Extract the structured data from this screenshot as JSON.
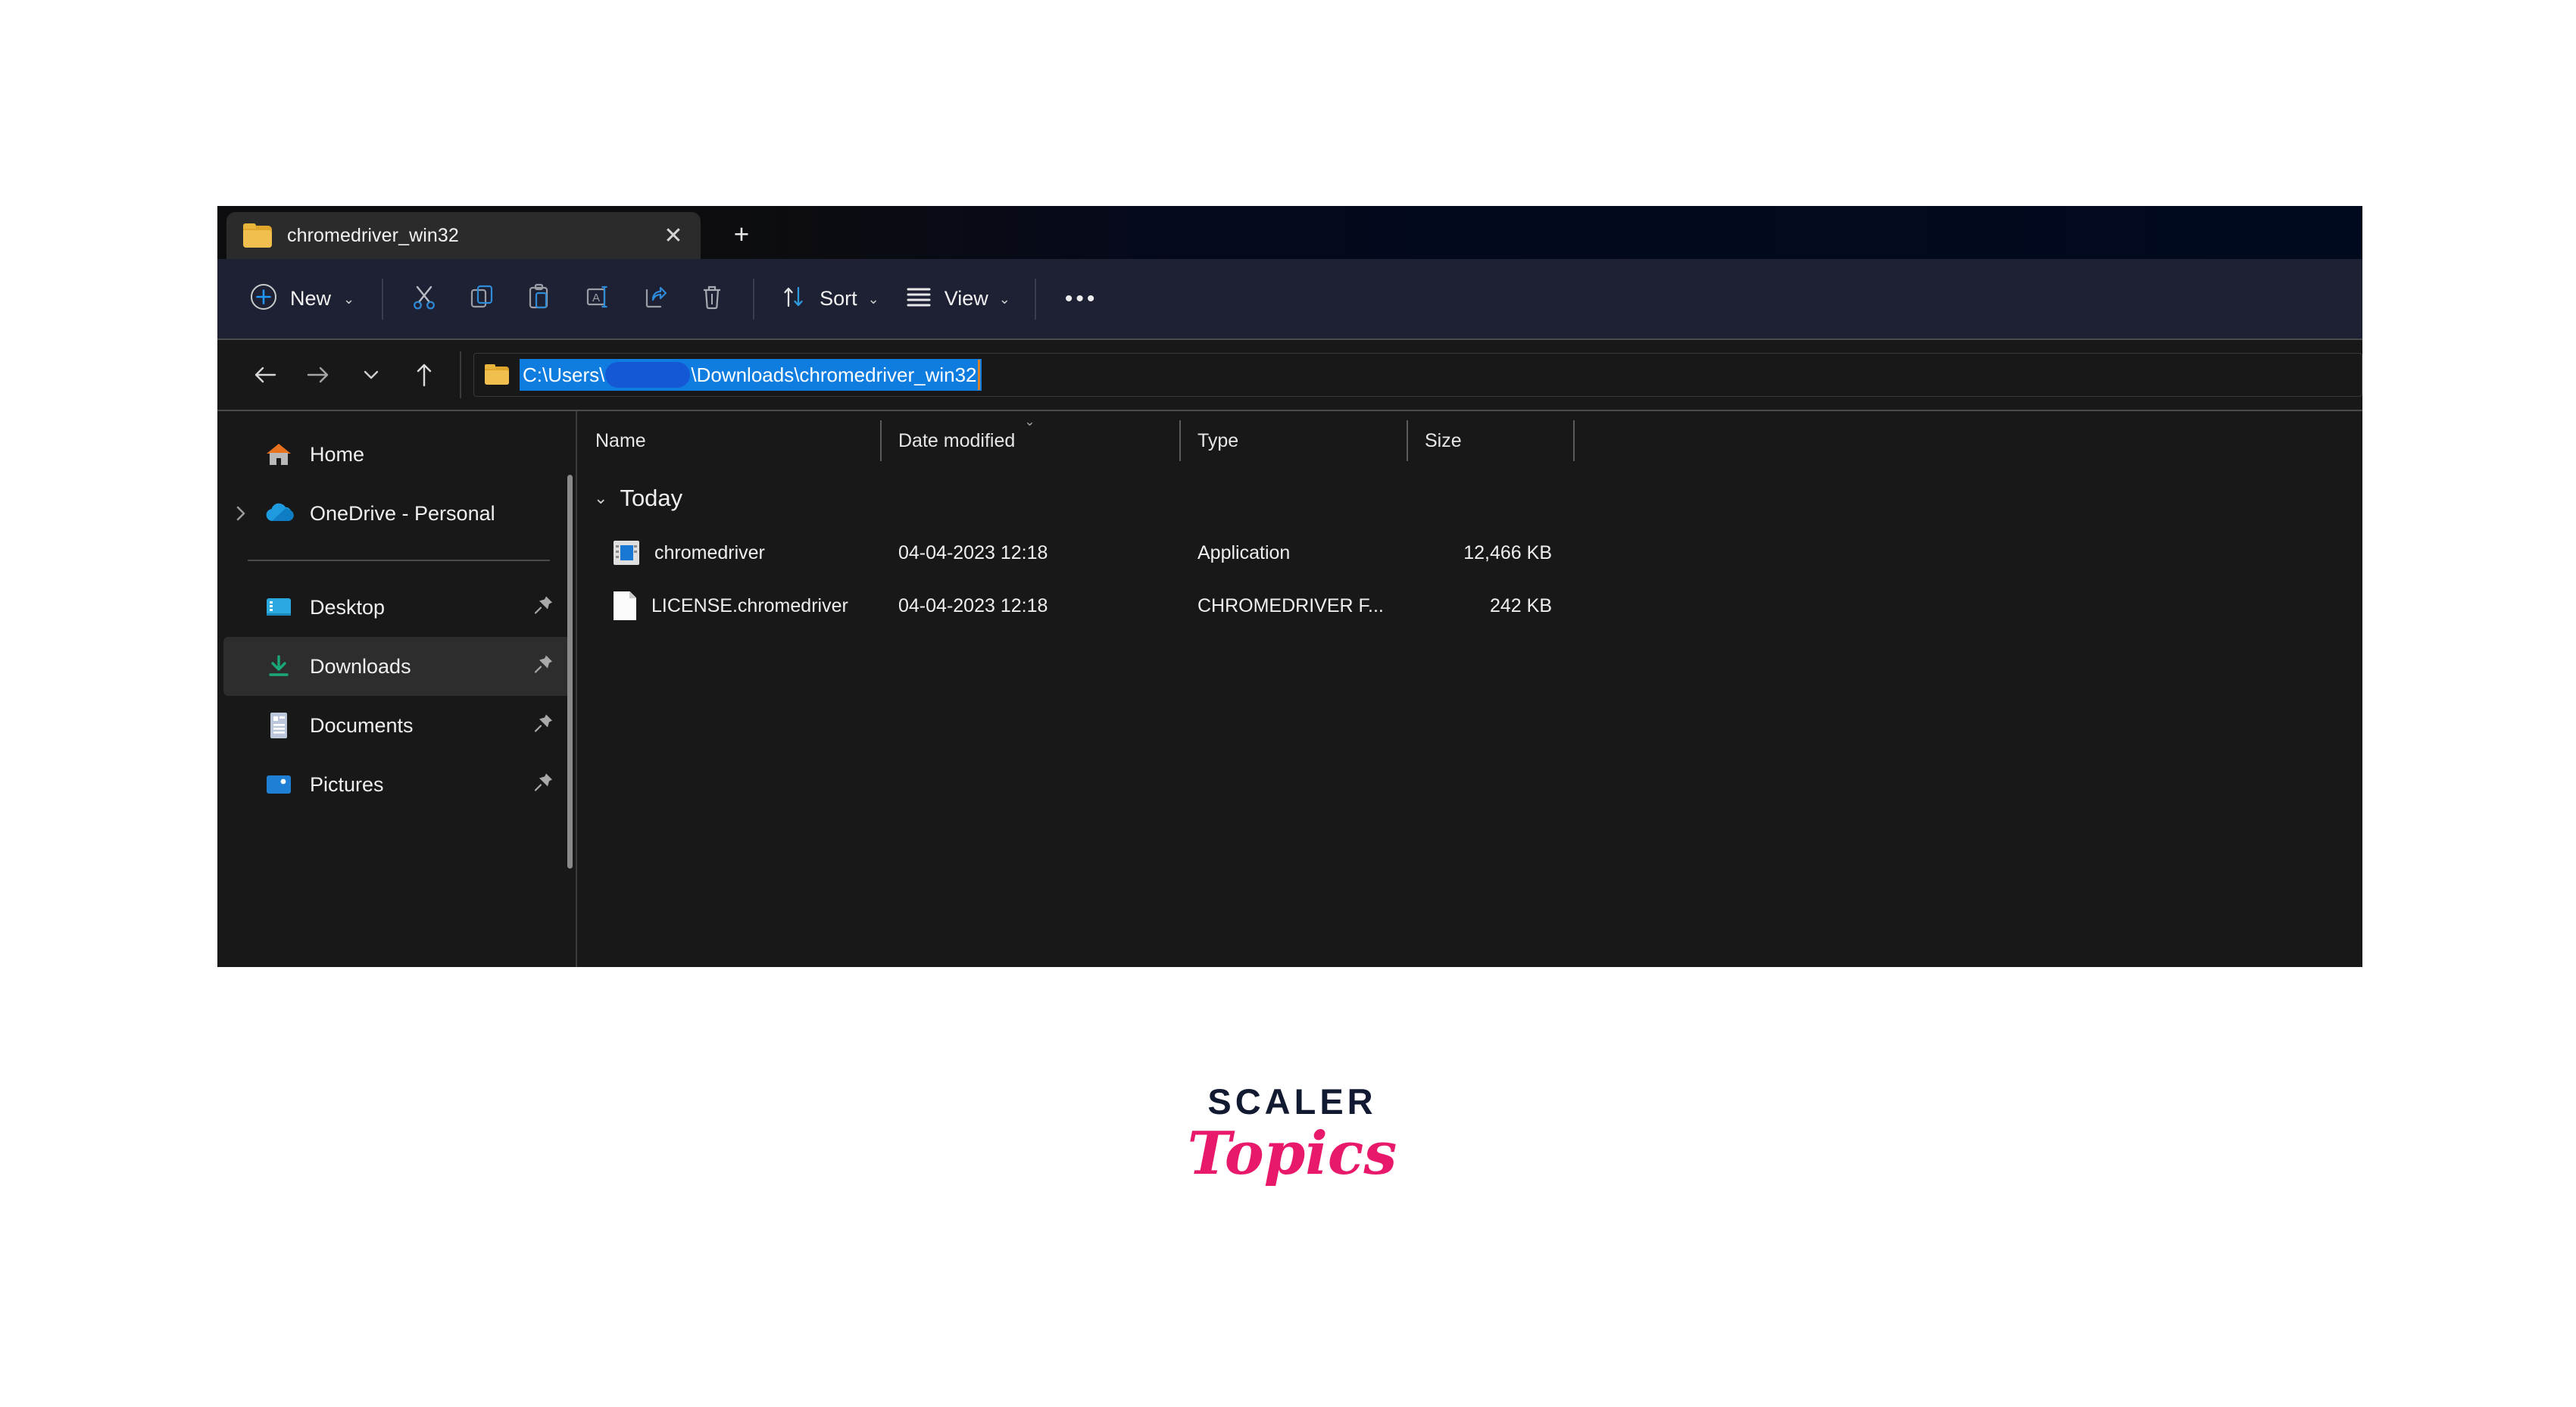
{
  "window": {
    "tab": {
      "title": "chromedriver_win32",
      "folder_icon": "folder-icon",
      "close_icon": "close-icon",
      "close_glyph": "✕"
    },
    "new_tab_glyph": "+",
    "new_tab_icon": "plus-icon"
  },
  "toolbar": {
    "new_label": "New",
    "new_icon": "circle-plus-icon",
    "chevron": "⌄",
    "actions": [
      {
        "name": "cut-button",
        "icon": "scissors-icon"
      },
      {
        "name": "copy-button",
        "icon": "copy-icon"
      },
      {
        "name": "paste-button",
        "icon": "clipboard-paste-icon"
      },
      {
        "name": "rename-button",
        "icon": "rename-icon"
      },
      {
        "name": "share-button",
        "icon": "share-icon"
      },
      {
        "name": "delete-button",
        "icon": "trash-icon"
      }
    ],
    "sort_label": "Sort",
    "sort_icon": "sort-arrows-icon",
    "view_label": "View",
    "view_icon": "list-lines-icon",
    "more_label": "•••",
    "more_icon": "ellipsis-icon"
  },
  "navigation": {
    "back_icon": "arrow-left-icon",
    "forward_icon": "arrow-right-icon",
    "recent_icon": "chevron-down-icon",
    "up_icon": "arrow-up-icon"
  },
  "address": {
    "folder_icon": "folder-icon",
    "path_prefix": "C:\\Users\\",
    "path_suffix": "\\Downloads\\chromedriver_win32",
    "redacted": true
  },
  "sidebar": {
    "items": [
      {
        "label": "Home",
        "icon": "home-icon",
        "expandable": false,
        "pinned": false,
        "selected": false
      },
      {
        "label": "OneDrive - Personal",
        "icon": "cloud-icon",
        "expandable": true,
        "pinned": false,
        "selected": false
      },
      {
        "label": "Desktop",
        "icon": "desktop-icon",
        "expandable": false,
        "pinned": true,
        "selected": false
      },
      {
        "label": "Downloads",
        "icon": "download-icon",
        "expandable": false,
        "pinned": true,
        "selected": true
      },
      {
        "label": "Documents",
        "icon": "documents-icon",
        "expandable": false,
        "pinned": true,
        "selected": false
      },
      {
        "label": "Pictures",
        "icon": "pictures-icon",
        "expandable": false,
        "pinned": true,
        "selected": false
      }
    ]
  },
  "file_list": {
    "columns": [
      {
        "label": "Name"
      },
      {
        "label": "Date modified",
        "sorted": true,
        "sort_glyph": "⌄"
      },
      {
        "label": "Type"
      },
      {
        "label": "Size"
      }
    ],
    "group": {
      "label": "Today",
      "chevron": "⌄"
    },
    "rows": [
      {
        "name": "chromedriver",
        "date_modified": "04-04-2023 12:18",
        "type": "Application",
        "size": "12,466 KB",
        "icon": "application-icon"
      },
      {
        "name": "LICENSE.chromedriver",
        "date_modified": "04-04-2023 12:18",
        "type": "CHROMEDRIVER F...",
        "size": "242 KB",
        "icon": "file-document-icon"
      }
    ]
  },
  "logo": {
    "top": "SCALER",
    "bottom": "Topics",
    "top_color": "#111a30",
    "bottom_color": "#e8196a"
  }
}
